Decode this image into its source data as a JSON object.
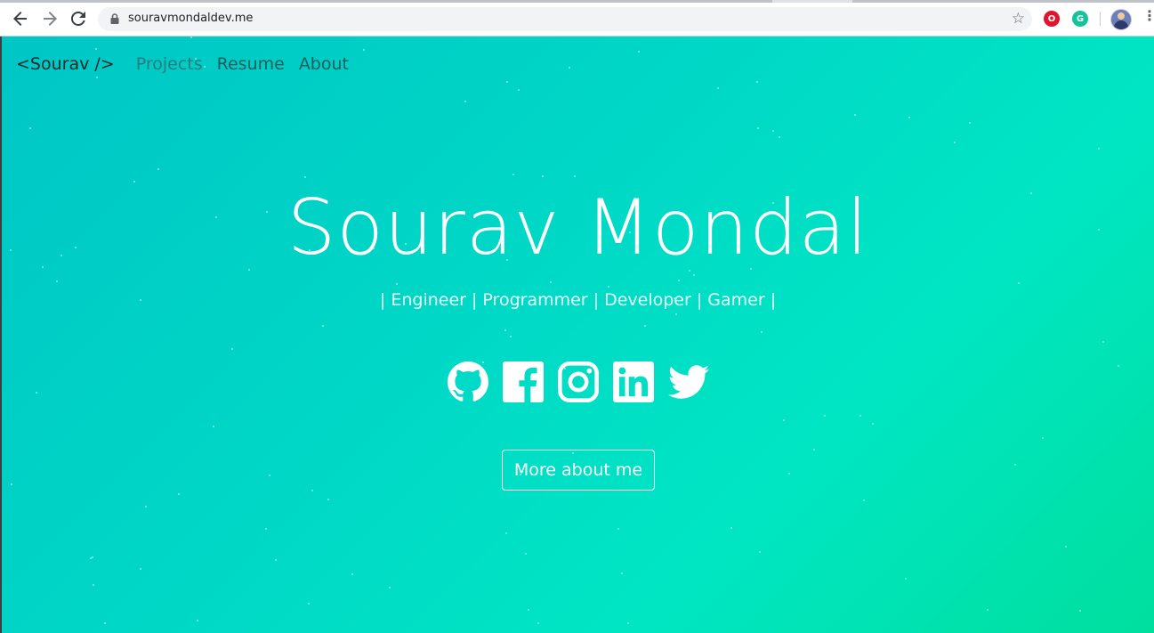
{
  "browser": {
    "url": "souravmondaldev.me",
    "back_icon": "arrow-left-icon",
    "forward_icon": "arrow-right-icon",
    "reload_icon": "reload-icon",
    "bookmark_icon": "star-icon",
    "extensions": [
      "opera-vpn-icon",
      "grammarly-icon"
    ],
    "profile_icon": "avatar-icon",
    "menu_icon": "kebab-menu-icon"
  },
  "nav": {
    "brand": "<Sourav />",
    "links": [
      "Projects",
      "Resume",
      "About"
    ]
  },
  "hero": {
    "name": "Sourav Mondal",
    "tagline": "| Engineer | Programmer | Developer | Gamer |",
    "socials": [
      "github-icon",
      "facebook-icon",
      "instagram-icon",
      "linkedin-icon",
      "twitter-icon"
    ],
    "cta": "More about me"
  },
  "colors": {
    "gradient_start": "#00c6c6",
    "gradient_end": "#00df9e",
    "text_light": "#ffffff"
  }
}
